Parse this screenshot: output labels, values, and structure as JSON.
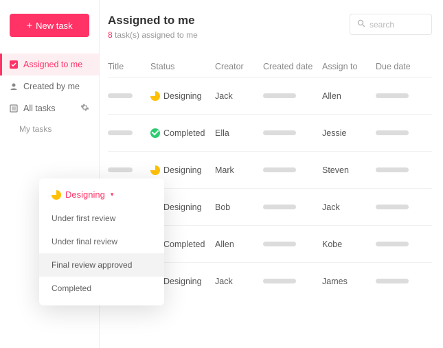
{
  "sidebar": {
    "new_task_label": "New task",
    "items": [
      {
        "label": "Assigned to me",
        "active": true
      },
      {
        "label": "Created by me"
      },
      {
        "label": "All tasks"
      }
    ],
    "sub_label": "My tasks"
  },
  "header": {
    "title": "Assigned to me",
    "count": "8",
    "count_suffix": " task(s) assigned to me"
  },
  "search": {
    "placeholder": "search"
  },
  "columns": {
    "title": "Title",
    "status": "Status",
    "creator": "Creator",
    "created_date": "Created date",
    "assign_to": "Assign to",
    "due_date": "Due date"
  },
  "rows": [
    {
      "status": "Designing",
      "status_kind": "designing",
      "creator": "Jack",
      "assign_to": "Allen"
    },
    {
      "status": "Completed",
      "status_kind": "completed",
      "creator": "Ella",
      "assign_to": "Jessie"
    },
    {
      "status": "Designing",
      "status_kind": "designing",
      "creator": "Mark",
      "assign_to": "Steven"
    },
    {
      "status": "Designing",
      "status_kind": "designing",
      "creator": "Bob",
      "assign_to": "Jack"
    },
    {
      "status": "Completed",
      "status_kind": "completed",
      "creator": "Allen",
      "assign_to": "Kobe"
    },
    {
      "status": "Designing",
      "status_kind": "designing",
      "creator": "Jack",
      "assign_to": "James"
    }
  ],
  "popover": {
    "current": "Designing",
    "options": [
      "Under first review",
      "Under final review",
      "Final review approved",
      "Completed"
    ],
    "highlighted_index": 2
  }
}
